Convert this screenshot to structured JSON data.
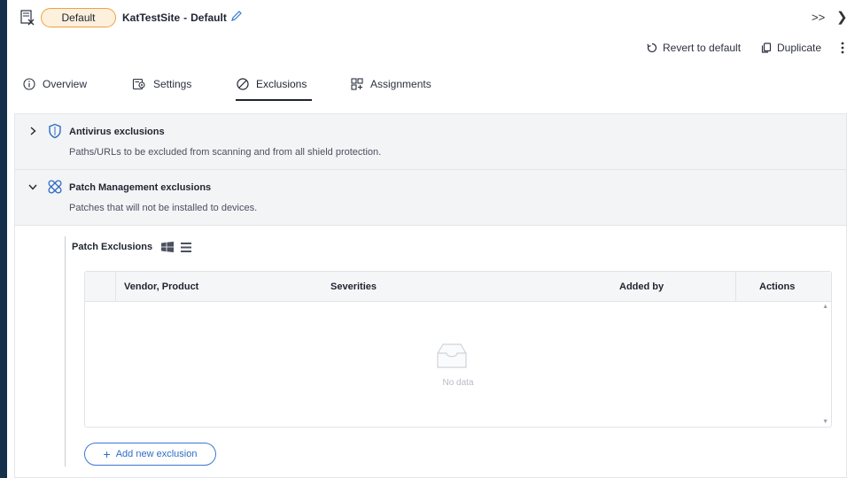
{
  "header": {
    "badge": "Default",
    "site_name": "KatTestSite",
    "separator": "-",
    "policy_name": "Default",
    "collapse_label": ">>"
  },
  "actions": {
    "revert": "Revert to default",
    "duplicate": "Duplicate"
  },
  "tabs": [
    {
      "label": "Overview",
      "icon": "info-icon"
    },
    {
      "label": "Settings",
      "icon": "settings-icon"
    },
    {
      "label": "Exclusions",
      "icon": "no-entry-icon",
      "active": true
    },
    {
      "label": "Assignments",
      "icon": "assignments-icon"
    }
  ],
  "sections": [
    {
      "title": "Antivirus exclusions",
      "description": "Paths/URLs to be excluded from scanning and from all shield protection.",
      "icon": "shield-icon",
      "expanded": false
    },
    {
      "title": "Patch Management exclusions",
      "description": "Patches that will not be installed to devices.",
      "icon": "bandage-icon",
      "expanded": true
    }
  ],
  "patch_exclusions": {
    "title": "Patch Exclusions",
    "columns": [
      "Vendor, Product",
      "Severities",
      "Added by",
      "Actions"
    ],
    "rows": [],
    "empty_text": "No data",
    "add_button": "Add new exclusion"
  },
  "colors": {
    "accent": "#2f6cc4",
    "badge_border": "#f0a040",
    "badge_bg": "#fdf0dd",
    "sidebar": "#14304a"
  }
}
